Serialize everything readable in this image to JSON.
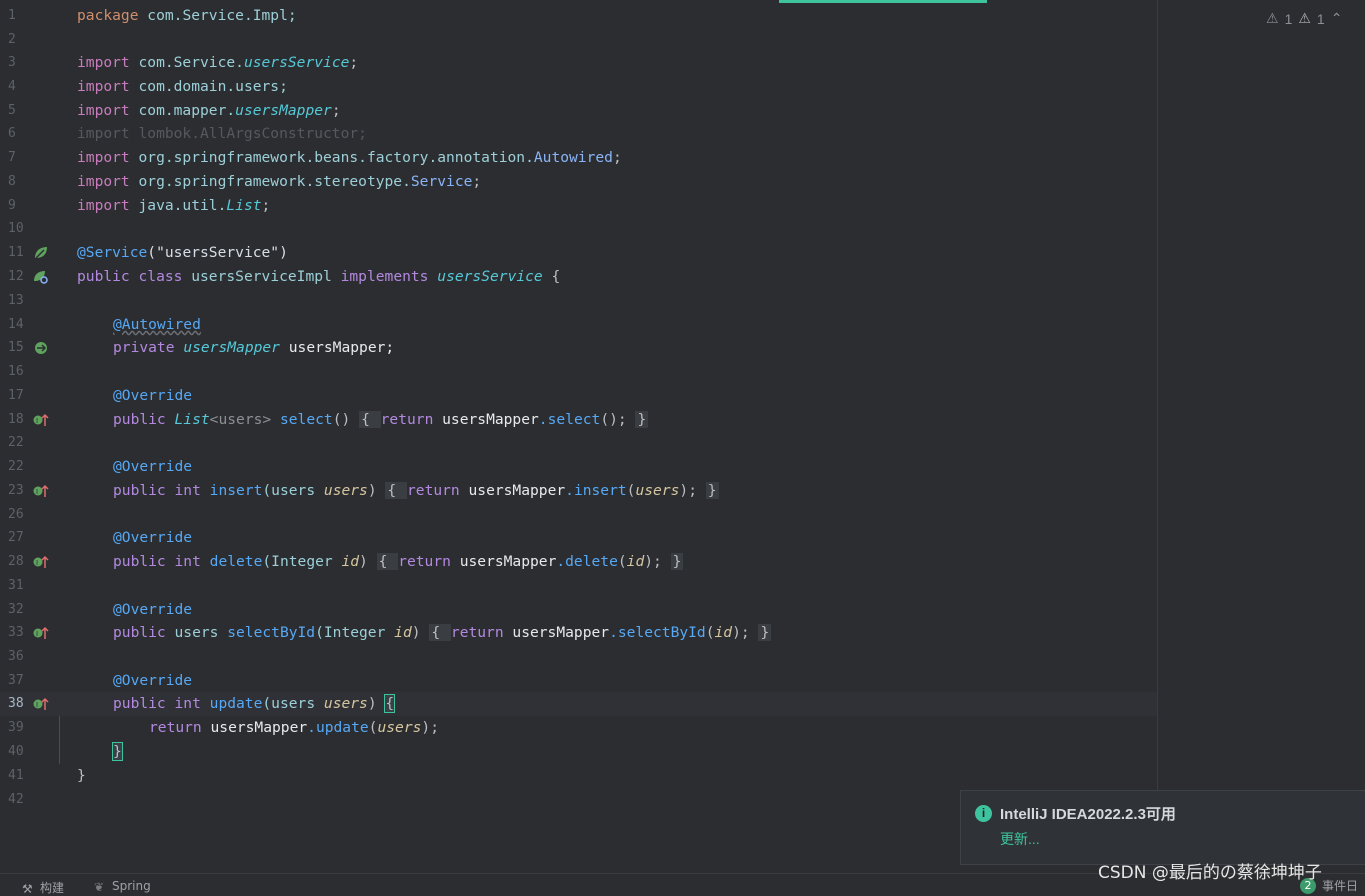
{
  "editor": {
    "lines": [
      {
        "n": "1",
        "text": "package com.Service.Impl;"
      },
      {
        "n": "2",
        "text": ""
      },
      {
        "n": "3",
        "text": "import com.Service.usersService;"
      },
      {
        "n": "4",
        "text": "import com.domain.users;"
      },
      {
        "n": "5",
        "text": "import com.mapper.usersMapper;"
      },
      {
        "n": "6",
        "text": "import lombok.AllArgsConstructor;"
      },
      {
        "n": "7",
        "text": "import org.springframework.beans.factory.annotation.Autowired;"
      },
      {
        "n": "8",
        "text": "import org.springframework.stereotype.Service;"
      },
      {
        "n": "9",
        "text": "import java.util.List;"
      },
      {
        "n": "10",
        "text": ""
      },
      {
        "n": "11",
        "text": "@Service(\"usersService\")"
      },
      {
        "n": "12",
        "text": "public class usersServiceImpl implements usersService {"
      },
      {
        "n": "13",
        "text": ""
      },
      {
        "n": "14",
        "text": "@Autowired"
      },
      {
        "n": "15",
        "text": "private usersMapper usersMapper;"
      },
      {
        "n": "16",
        "text": ""
      },
      {
        "n": "17",
        "text": "@Override"
      },
      {
        "n": "18",
        "text": "public List<users> select() { return usersMapper.select(); }"
      },
      {
        "n": "22",
        "text": ""
      },
      {
        "n": "22b",
        "text": "@Override"
      },
      {
        "n": "23",
        "text": "public int insert(users users) { return usersMapper.insert(users); }"
      },
      {
        "n": "26",
        "text": ""
      },
      {
        "n": "27",
        "text": "@Override"
      },
      {
        "n": "28",
        "text": "public int delete(Integer id) { return usersMapper.delete(id); }"
      },
      {
        "n": "31",
        "text": ""
      },
      {
        "n": "32",
        "text": "@Override"
      },
      {
        "n": "33",
        "text": "public users selectById(Integer id) { return usersMapper.selectById(id); }"
      },
      {
        "n": "36",
        "text": ""
      },
      {
        "n": "37",
        "text": "@Override"
      },
      {
        "n": "38",
        "text": "public int update(users users) {"
      },
      {
        "n": "39",
        "text": "return usersMapper.update(users);"
      },
      {
        "n": "40",
        "text": "}"
      },
      {
        "n": "41",
        "text": "}"
      },
      {
        "n": "42",
        "text": ""
      }
    ],
    "line_numbers": [
      "1",
      "2",
      "3",
      "4",
      "5",
      "6",
      "7",
      "8",
      "9",
      "10",
      "11",
      "12",
      "13",
      "14",
      "15",
      "16",
      "17",
      "18",
      "22",
      "23",
      "26",
      "27",
      "28",
      "31",
      "32",
      "33",
      "36",
      "37",
      "38",
      "39",
      "40",
      "41",
      "42"
    ],
    "warnings": {
      "weak": "1",
      "warn": "1"
    }
  },
  "code": {
    "l1a": "package",
    "l1b": " com.Service.Impl;",
    "imp": "import",
    "l3a": " com.Service.",
    "l3b": "usersService",
    "l3c": ";",
    "l4": " com.domain.users;",
    "l5a": " com.mapper.",
    "l5b": "usersMapper",
    "l5c": ";",
    "l6": "import lombok.AllArgsConstructor;",
    "l7a": " org.springframework.beans.factory.annotation.",
    "l7b": "Autowired",
    "l7c": ";",
    "l8a": " org.springframework.stereotype.",
    "l8b": "Service",
    "l8c": ";",
    "l9a": " java.util.",
    "l9b": "List",
    "l9c": ";",
    "l11a": "@Service",
    "l11b": "(\"usersService\")",
    "public": "public",
    "class": "class",
    "implements": "implements",
    "private": "private",
    "int": "int",
    "return": "return",
    "l12a": " usersServiceImpl ",
    "l12b": "usersService",
    "l12c": " {",
    "autowired": "@Autowired",
    "l15a": "usersMapper",
    "l15b": " usersMapper;",
    "override": "@Override",
    "l18a": "List",
    "l18b": "<users>",
    "l18c": " select",
    "l18d": "() ",
    "l18e": "{ ",
    "l18f": " usersMapper",
    "l18g": ".select",
    "l18h": "(); ",
    "l18i": "}",
    "l23a": " insert",
    "l23b": "(users ",
    "l23c": "users",
    "l23d": ") ",
    "l23e": "{ ",
    "l23f": " usersMapper",
    "l23g": ".insert",
    "l23h": "(",
    "l23i": "users",
    "l23j": "); ",
    "l23k": "}",
    "l28a": " delete",
    "l28b": "(Integer ",
    "l28c": "id",
    "l28d": ") ",
    "l28e": "{ ",
    "l28f": " usersMapper",
    "l28g": ".delete",
    "l28h": "(",
    "l28i": "id",
    "l28j": "); ",
    "l28k": "}",
    "l33a": " users",
    "l33b": " selectById",
    "l33c": "(Integer ",
    "l33d": "id",
    "l33e": ") ",
    "l33f": "{ ",
    "l33g": " usersMapper",
    "l33h": ".selectById",
    "l33i": "(",
    "l33j": "id",
    "l33k": "); ",
    "l33l": "}",
    "l38a": " update",
    "l38b": "(users ",
    "l38c": "users",
    "l38d": ") ",
    "l38e": "{",
    "l39a": " usersMapper",
    "l39b": ".update",
    "l39c": "(",
    "l39d": "users",
    "l39e": ");",
    "l40": "}",
    "l41": "}"
  },
  "notification": {
    "title": "IntelliJ IDEA2022.2.3可用",
    "link": "更新..."
  },
  "watermark": "CSDN @最后的の蔡徐坤坤子",
  "statusbar": {
    "build": "构建",
    "spring": "Spring",
    "events": "事件日",
    "events_count": "2"
  },
  "colors": {
    "accent": "#3fc39e",
    "background": "#2b2d30"
  }
}
